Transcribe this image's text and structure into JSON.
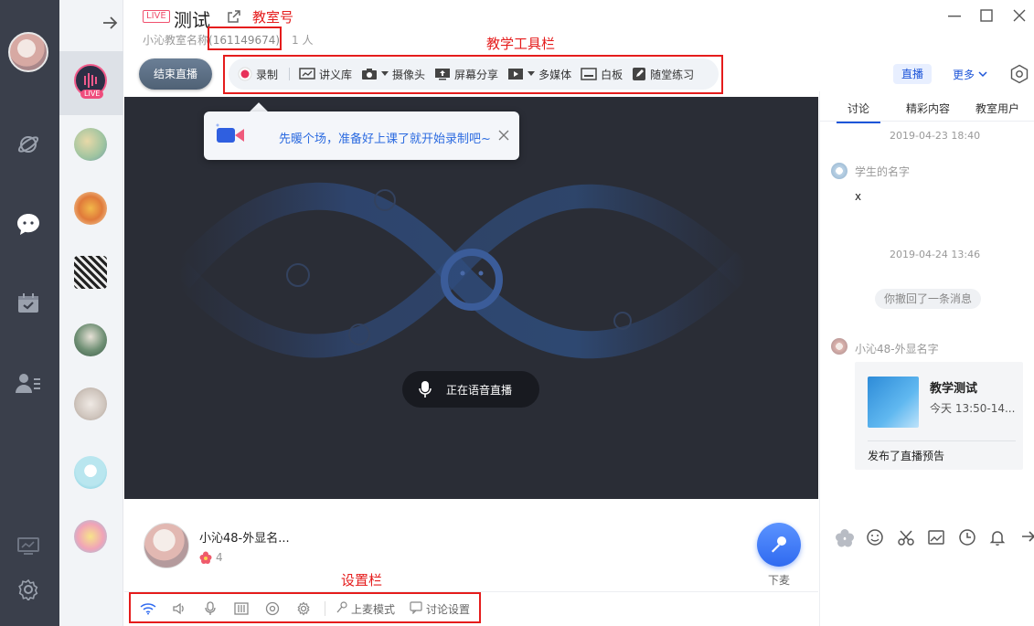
{
  "rail": {
    "icons": [
      "planet-icon",
      "chat-bubble-icon",
      "calendar-check-icon",
      "contacts-icon",
      "screen-icon",
      "settings-icon"
    ]
  },
  "chat_list": {
    "live_badge": "LIVE"
  },
  "header": {
    "live_tag": "LIVE",
    "title": "测试",
    "subtitle_prefix": "小沁教室名称",
    "room_id": "(161149674)",
    "member_count": "1 人",
    "annotation_room_no": "教室号",
    "annotation_toolbar": "教学工具栏"
  },
  "toolbar": {
    "end_live": "结束直播",
    "record": "录制",
    "slides": "讲义库",
    "camera": "摄像头",
    "screen_share": "屏幕分享",
    "multimedia": "多媒体",
    "whiteboard": "白板",
    "quiz": "随堂练习"
  },
  "top_right": {
    "live_tab": "直播",
    "more": "更多"
  },
  "stage": {
    "toast_text": "先暖个场，准备好上课了就开始录制吧~",
    "voice_status": "正在语音直播"
  },
  "host": {
    "name": "小沁48-外显名...",
    "score": "4",
    "mic_label": "下麦"
  },
  "settings_bar": {
    "annotation": "设置栏",
    "mic_mode": "上麦模式",
    "discussion_settings": "讨论设置"
  },
  "right_panel": {
    "tabs": [
      "讨论",
      "精彩内容",
      "教室用户"
    ],
    "timestamp1": "2019-04-23  18:40",
    "student_name": "学生的名字",
    "student_msg": "x",
    "timestamp2": "2019-04-24  13:46",
    "recall_notice": "你撤回了一条消息",
    "sender2": "小沁48-外显名字",
    "card": {
      "title": "教学测试",
      "time": "今天  13:50-14...",
      "footer": "发布了直播预告"
    }
  },
  "colors": {
    "accent_blue": "#1d55d8",
    "annotation_red": "#e51c1c",
    "live_pink": "#f0506e",
    "rail_bg": "#3a3f4b",
    "stage_bg": "#2a2d36"
  }
}
